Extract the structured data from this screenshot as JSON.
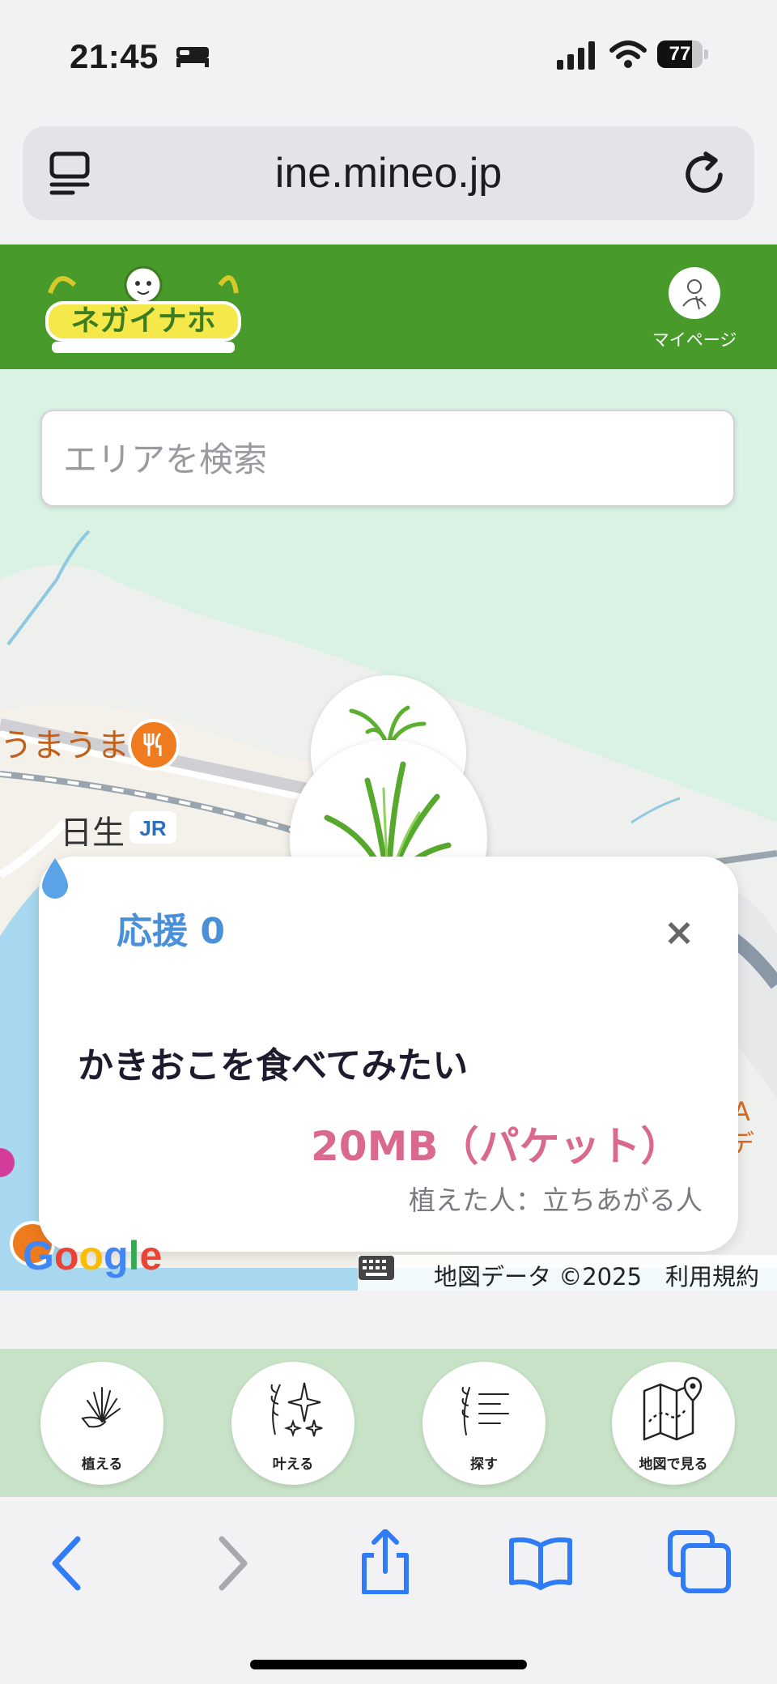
{
  "status_bar": {
    "time": "21:45",
    "battery": "77",
    "battery_level": 0.77
  },
  "browser": {
    "url": "ine.mineo.jp"
  },
  "site_header": {
    "logo_alt": "ネガイナホ",
    "mypage_label": "マイページ"
  },
  "search": {
    "placeholder": "エリアを検索"
  },
  "map": {
    "poi_label": "うまうま",
    "station_label": "日生",
    "attribution_data": "地図データ ©2025",
    "attribution_terms": "利用規約",
    "google": "Google"
  },
  "popup": {
    "support_label": "応援 0",
    "close": "×",
    "wish_title": "かきおこを食べてみたい",
    "reward": "20MB（パケット）",
    "planter": "植えた人：立ちあがる人"
  },
  "site_nav": [
    {
      "label": "植える",
      "icon": "plant-icon"
    },
    {
      "label": "叶える",
      "icon": "sparkle-icon"
    },
    {
      "label": "探す",
      "icon": "search-list-icon"
    },
    {
      "label": "地図で見る",
      "icon": "map-icon"
    }
  ],
  "colors": {
    "header_green": "#489a2b",
    "map_green": "#d9f2e3",
    "support_blue": "#4a90d9",
    "reward_pink": "#d96a8e",
    "safari_blue": "#2f7cf6"
  }
}
